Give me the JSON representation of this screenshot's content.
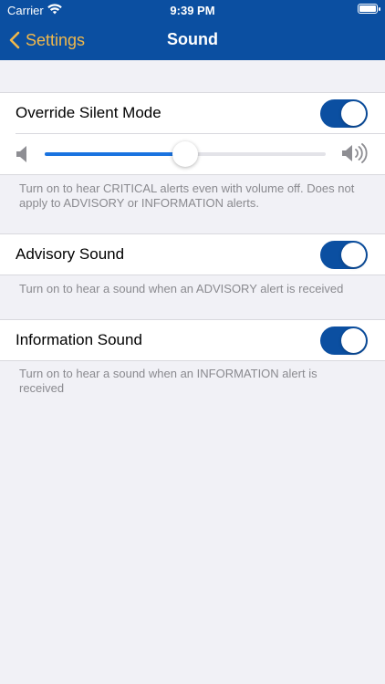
{
  "status_bar": {
    "carrier": "Carrier",
    "time": "9:39 PM",
    "wifi_icon": "wifi-icon",
    "battery_icon": "battery-icon"
  },
  "nav": {
    "back_label": "Settings",
    "title": "Sound",
    "back_icon": "chevron-left-icon"
  },
  "override_silent": {
    "label": "Override Silent Mode",
    "enabled": true,
    "volume_level": 0.5,
    "description": "Turn on to hear CRITICAL alerts even with volume off. Does not apply to ADVISORY or INFORMATION alerts."
  },
  "advisory": {
    "label": "Advisory Sound",
    "enabled": true,
    "description": "Turn on to hear a sound when an ADVISORY alert is received"
  },
  "information": {
    "label": "Information Sound",
    "enabled": true,
    "description": "Turn on to hear a sound when an INFORMATION alert is received"
  },
  "colors": {
    "nav_bar": "#0b4fa1",
    "back_accent": "#f1b84b",
    "toggle_on": "#0b4fa1",
    "slider_fill": "#1a73e0",
    "background": "#f1f1f6"
  }
}
